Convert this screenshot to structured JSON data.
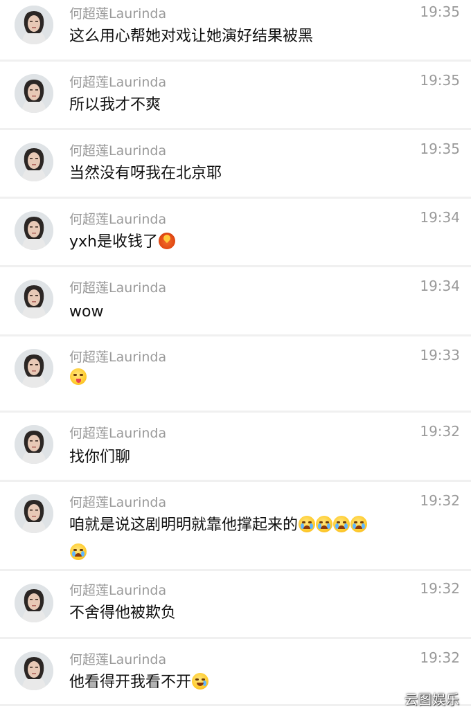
{
  "messages": [
    {
      "name": "何超莲Laurinda",
      "time": "19:35",
      "text": "这么用心帮她对戏让她演好结果被黑",
      "emoji": []
    },
    {
      "name": "何超莲Laurinda",
      "time": "19:35",
      "text": "所以我才不爽",
      "emoji": []
    },
    {
      "name": "何超莲Laurinda",
      "time": "19:35",
      "text": "当然没有呀我在北京耶",
      "emoji": []
    },
    {
      "name": "何超莲Laurinda",
      "time": "19:34",
      "text": "yxh是收钱了",
      "emoji": [
        "fire-emoji"
      ]
    },
    {
      "name": "何超莲Laurinda",
      "time": "19:34",
      "text": "wow",
      "emoji": []
    },
    {
      "name": "何超莲Laurinda",
      "time": "19:33",
      "text": "",
      "emoji": [
        "dizzy-face-emoji"
      ]
    },
    {
      "name": "何超莲Laurinda",
      "time": "19:32",
      "text": "找你们聊",
      "emoji": []
    },
    {
      "name": "何超莲Laurinda",
      "time": "19:32",
      "text": "咱就是说这剧明明就靠他撑起来的",
      "emoji": [
        "crying-face-emoji",
        "crying-face-emoji",
        "crying-face-emoji",
        "crying-face-emoji",
        "crying-face-emoji"
      ]
    },
    {
      "name": "何超莲Laurinda",
      "time": "19:32",
      "text": "不舍得他被欺负",
      "emoji": []
    },
    {
      "name": "何超莲Laurinda",
      "time": "19:32",
      "text": "他看得开我看不开",
      "emoji": [
        "laughing-tears-emoji"
      ]
    }
  ],
  "watermark": "云图娱乐",
  "colors": {
    "name_text": "#9a9a9a",
    "message_text": "#111111",
    "divider": "#f0f0f0",
    "background": "#ffffff"
  }
}
